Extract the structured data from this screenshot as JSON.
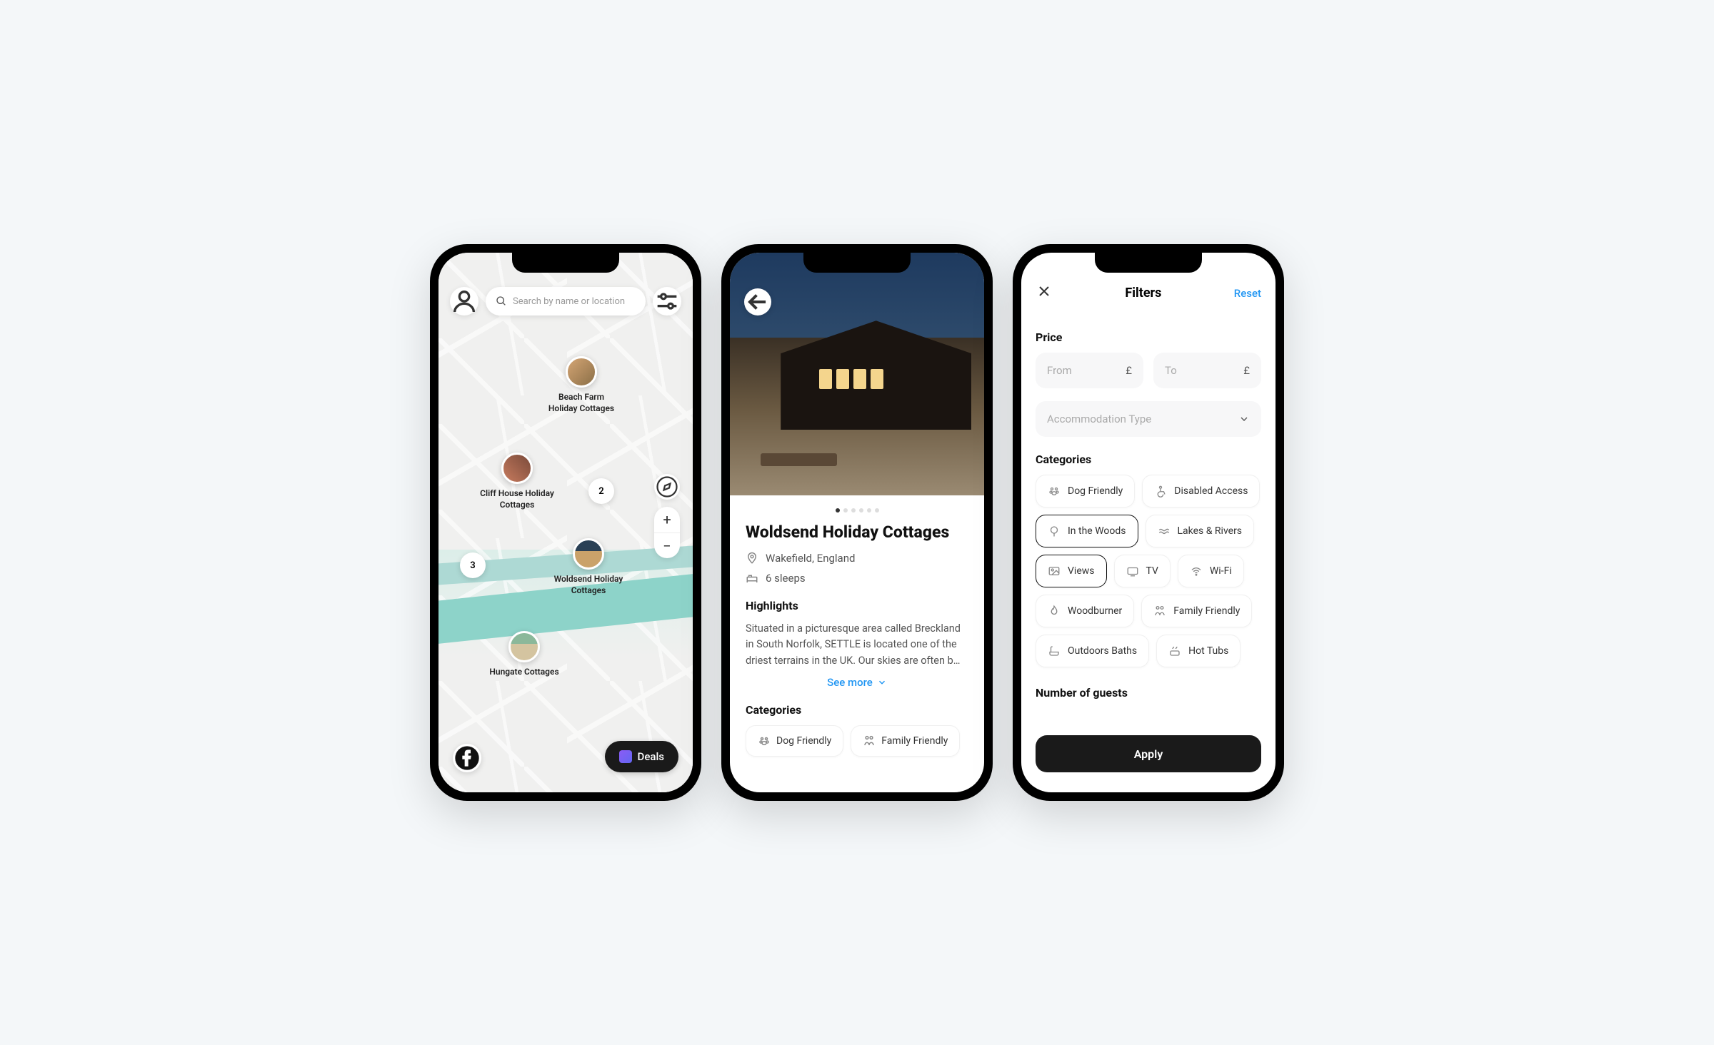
{
  "phone1": {
    "search_placeholder": "Search by name or location",
    "pins": [
      {
        "name": "Beach Farm\nHoliday Cottages"
      },
      {
        "name": "Cliff House Holiday\nCottages"
      },
      {
        "name": "Woldsend Holiday\nCottages"
      },
      {
        "name": "Hungate Cottages"
      }
    ],
    "clusters": [
      "2",
      "3"
    ],
    "deals_label": "Deals"
  },
  "phone2": {
    "title": "Woldsend Holiday Cottages",
    "location": "Wakefield, England",
    "sleeps": "6 sleeps",
    "highlights_h": "Highlights",
    "description": "Situated in a picturesque area called Breckland in South Norfolk, SETTLE is located one of the driest terrains in the UK. Our skies are often b…",
    "see_more": "See more",
    "categories_h": "Categories",
    "cats": [
      "Dog Friendly",
      "Family Friendly"
    ],
    "dots_count": 6,
    "active_dot": 0
  },
  "phone3": {
    "title": "Filters",
    "reset": "Reset",
    "price_h": "Price",
    "from_label": "From",
    "to_label": "To",
    "currency": "£",
    "accom_placeholder": "Accommodation Type",
    "categories_h": "Categories",
    "cats": [
      {
        "label": "Dog Friendly",
        "icon": "paw",
        "selected": false
      },
      {
        "label": "Disabled Access",
        "icon": "wheelchair",
        "selected": false
      },
      {
        "label": "In the Woods",
        "icon": "tree",
        "selected": true
      },
      {
        "label": "Lakes & Rivers",
        "icon": "waves",
        "selected": false
      },
      {
        "label": "Views",
        "icon": "image",
        "selected": true
      },
      {
        "label": "TV",
        "icon": "tv",
        "selected": false
      },
      {
        "label": "Wi-Fi",
        "icon": "wifi",
        "selected": false
      },
      {
        "label": "Woodburner",
        "icon": "fire",
        "selected": false
      },
      {
        "label": "Family Friendly",
        "icon": "family",
        "selected": false
      },
      {
        "label": "Outdoors Baths",
        "icon": "bath",
        "selected": false
      },
      {
        "label": "Hot Tubs",
        "icon": "hottub",
        "selected": false
      }
    ],
    "guests_h": "Number of guests",
    "apply": "Apply"
  }
}
